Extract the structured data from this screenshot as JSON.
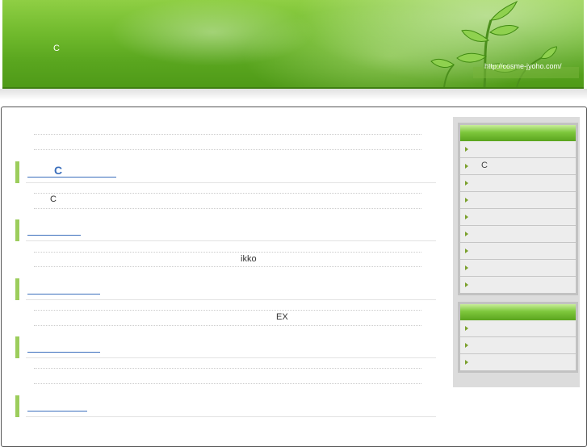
{
  "header": {
    "title_letter": "C",
    "site_url": "http://cosme-jyoho.com/"
  },
  "main": {
    "sections": [
      {
        "heading": "C",
        "text": "C"
      },
      {
        "heading": "",
        "text": "ikko"
      },
      {
        "heading": "",
        "text": "EX"
      },
      {
        "heading": "",
        "text": ""
      },
      {
        "heading": "",
        "text": ""
      }
    ]
  },
  "sidebar": {
    "box1_items": [
      "",
      "C",
      "",
      "",
      "",
      "",
      "",
      "",
      ""
    ],
    "box2_items": [
      "",
      "",
      ""
    ]
  },
  "colors": {
    "header_green": "#6fb92c",
    "link_blue": "#3a6ebc",
    "section_bar": "#9ccd5c"
  }
}
